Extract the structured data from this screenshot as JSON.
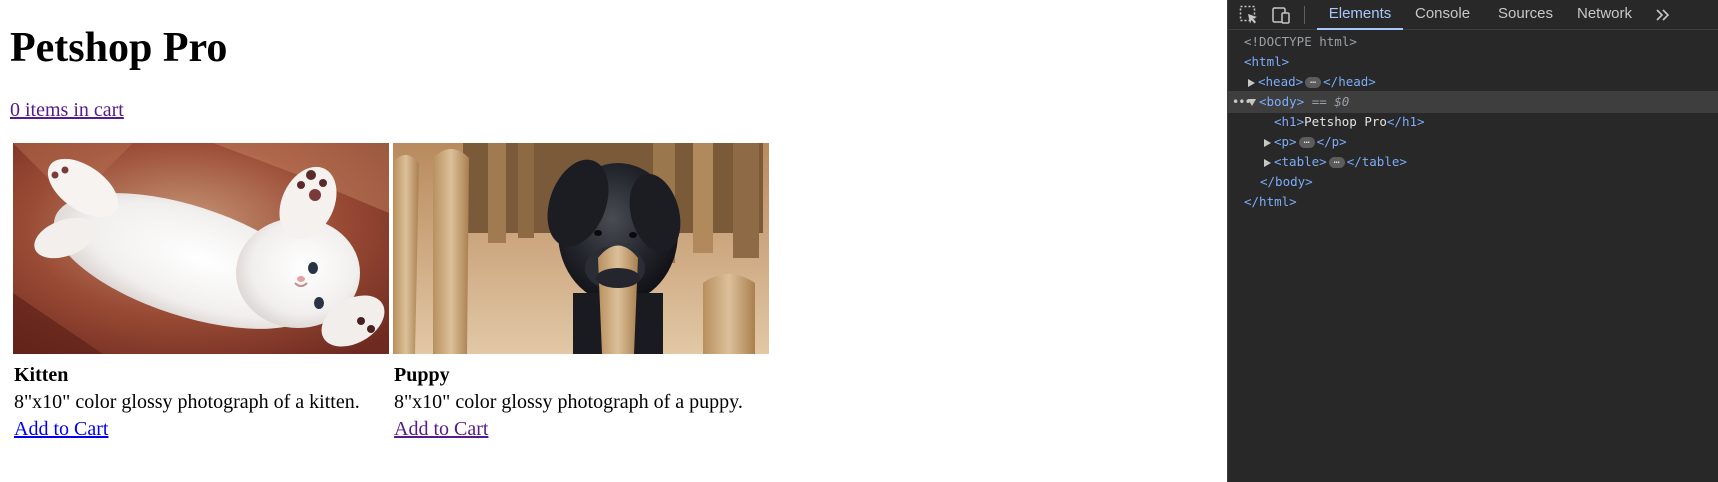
{
  "page": {
    "title": "Petshop Pro",
    "cart_link": "0 items in cart",
    "products": [
      {
        "name": "Kitten",
        "description": "8\"x10\" color glossy photograph of a kitten.",
        "add_label": "Add to Cart",
        "image_icon": "kitten-photo"
      },
      {
        "name": "Puppy",
        "description": "8\"x10\" color glossy photograph of a puppy.",
        "add_label": "Add to Cart",
        "image_icon": "puppy-photo"
      }
    ]
  },
  "devtools": {
    "toolbar": {
      "inspect_icon": "inspect-element-icon",
      "device_icon": "device-toggle-icon",
      "tabs": [
        {
          "label": "Elements",
          "active": true
        },
        {
          "label": "Console",
          "active": false
        },
        {
          "label": "Sources",
          "active": false
        },
        {
          "label": "Network",
          "active": false
        }
      ],
      "more_icon": "more-tabs-icon"
    },
    "dom": {
      "doctype": "<!DOCTYPE html>",
      "html_open": "<html>",
      "head": {
        "open": "<head>",
        "close": "</head>"
      },
      "body_open": "<body>",
      "selected_marker": "== $0",
      "h1_open": "<h1>",
      "h1_text": "Petshop Pro",
      "h1_close": "</h1>",
      "p": {
        "open": "<p>",
        "close": "</p>"
      },
      "table": {
        "open": "<table>",
        "close": "</table>"
      },
      "body_close": "</body>",
      "html_close": "</html>",
      "ellipsis": "…"
    },
    "colors": {
      "background": "#282828",
      "tag": "#7cacf8",
      "active_tab": "#a8c7fa"
    }
  }
}
